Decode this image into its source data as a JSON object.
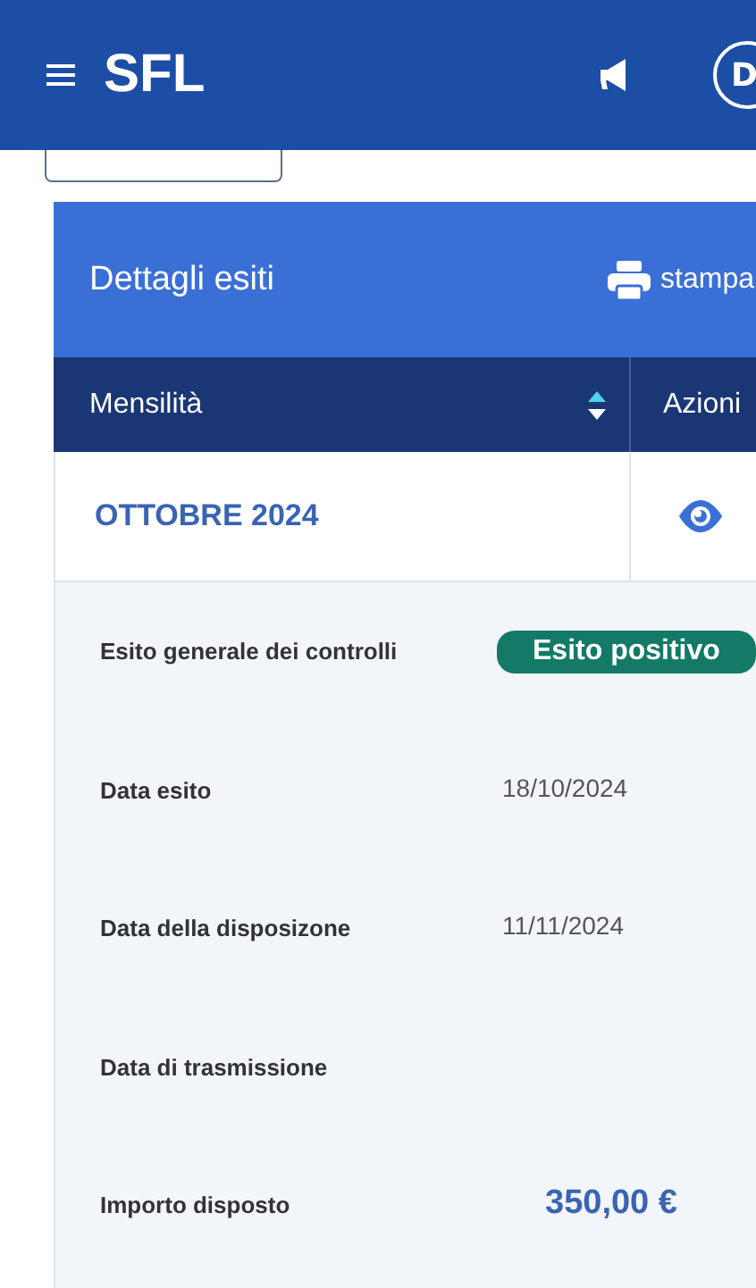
{
  "header": {
    "logo": "SFL",
    "avatar": "D"
  },
  "card": {
    "title": "Dettagli esiti",
    "print_label": "stampa",
    "table": {
      "columns": [
        "Mensilità",
        "Azioni"
      ],
      "rows": [
        {
          "month": "OTTOBRE 2024"
        }
      ]
    },
    "details": [
      {
        "label": "Esito generale dei controlli",
        "kind": "badge",
        "value": "Esito positivo"
      },
      {
        "label": "Data esito",
        "kind": "text",
        "value": "18/10/2024"
      },
      {
        "label": "Data della disposizone",
        "kind": "text",
        "value": "11/11/2024"
      },
      {
        "label": "Data di trasmissione"
      },
      {
        "label": "Importo disposto",
        "kind": "amount",
        "value": "350,00 €"
      }
    ]
  }
}
